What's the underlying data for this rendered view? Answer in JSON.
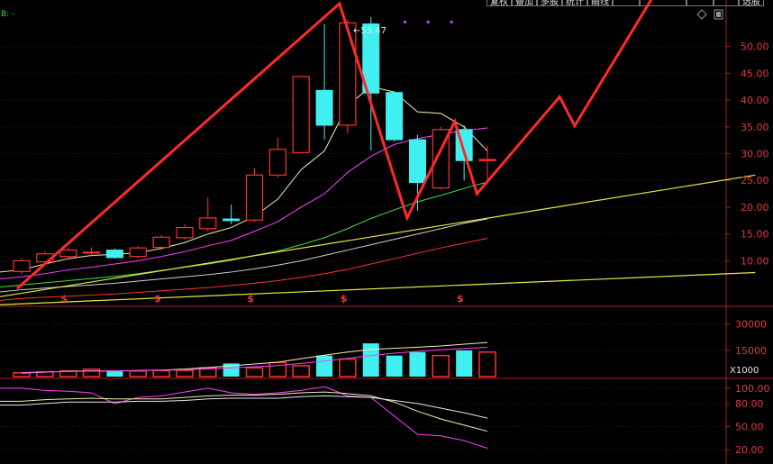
{
  "header": {
    "tabs": [
      "复权",
      "叠加",
      "多股",
      "统计",
      "画线",
      "",
      "",
      "",
      "",
      "选股"
    ],
    "indicator_text": "B: -",
    "icons": [
      "diamond-icon",
      "window-icon",
      "close-icon"
    ]
  },
  "chart_data": {
    "type": "candlestick",
    "price_axis": {
      "ticks": [
        10,
        15,
        20,
        25,
        30,
        35,
        40,
        45,
        50
      ],
      "ylim": [
        1.5,
        58
      ],
      "tick_labels": [
        "10.00",
        "15.00",
        "20.00",
        "25.00",
        "30.00",
        "35.00",
        "40.00",
        "45.00",
        "50.00"
      ]
    },
    "high_label": "55.47",
    "candles": [
      {
        "o": 8.0,
        "c": 10.0,
        "h": 10.5,
        "l": 7.5,
        "up": true
      },
      {
        "o": 9.8,
        "c": 11.3,
        "h": 11.8,
        "l": 9.5,
        "up": true
      },
      {
        "o": 10.8,
        "c": 12.0,
        "h": 12.4,
        "l": 10.5,
        "up": true
      },
      {
        "o": 11.5,
        "c": 11.6,
        "h": 12.5,
        "l": 10.8,
        "up": true
      },
      {
        "o": 12.0,
        "c": 10.6,
        "h": 12.3,
        "l": 10.4,
        "up": false
      },
      {
        "o": 10.8,
        "c": 12.4,
        "h": 12.8,
        "l": 10.5,
        "up": true
      },
      {
        "o": 12.5,
        "c": 14.4,
        "h": 14.8,
        "l": 12.0,
        "up": true
      },
      {
        "o": 14.3,
        "c": 16.2,
        "h": 16.8,
        "l": 14.0,
        "up": true
      },
      {
        "o": 16.0,
        "c": 18.0,
        "h": 21.8,
        "l": 15.5,
        "up": true
      },
      {
        "o": 17.5,
        "c": 17.8,
        "h": 20.5,
        "l": 16.8,
        "up": false
      },
      {
        "o": 17.6,
        "c": 26.0,
        "h": 27.3,
        "l": 17.3,
        "up": true
      },
      {
        "o": 26.0,
        "c": 30.8,
        "h": 33.0,
        "l": 25.5,
        "up": true
      },
      {
        "o": 30.2,
        "c": 44.4,
        "h": 44.4,
        "l": 30.2,
        "up": true
      },
      {
        "o": 41.8,
        "c": 35.3,
        "h": 54.2,
        "l": 32.6,
        "up": false
      },
      {
        "o": 35.3,
        "c": 54.4,
        "h": 55.0,
        "l": 33.7,
        "up": true
      },
      {
        "o": 54.2,
        "c": 41.3,
        "h": 55.5,
        "l": 30.6,
        "up": false
      },
      {
        "o": 41.4,
        "c": 32.6,
        "h": 41.5,
        "l": 32.2,
        "up": false
      },
      {
        "o": 32.6,
        "c": 24.6,
        "h": 33.5,
        "l": 19.3,
        "up": false
      },
      {
        "o": 23.6,
        "c": 34.5,
        "h": 35.0,
        "l": 23.3,
        "up": true
      },
      {
        "o": 34.5,
        "c": 28.7,
        "h": 35.3,
        "l": 25.0,
        "up": false
      },
      {
        "o": 28.7,
        "c": 28.9,
        "h": 31.5,
        "l": 24.3,
        "up": true
      }
    ],
    "moving_averages": [
      {
        "color": "#f0f0b0",
        "values": [
          8.3,
          9.4,
          10.4,
          11.0,
          11.2,
          11.5,
          12.3,
          13.4,
          15.0,
          16.2,
          18.3,
          21.5,
          27.0,
          30.5,
          39.0,
          42.5,
          41.5,
          37.8,
          37.5,
          35.0,
          30.5
        ]
      },
      {
        "color": "#ff40ff",
        "values": [
          7.0,
          7.6,
          8.3,
          8.8,
          9.4,
          10.0,
          10.8,
          11.7,
          12.8,
          13.8,
          15.5,
          17.3,
          20.0,
          22.5,
          26.5,
          29.5,
          31.7,
          32.8,
          33.6,
          34.3,
          34.8
        ]
      },
      {
        "color": "#40e040",
        "values": [
          5.5,
          5.9,
          6.3,
          6.7,
          7.1,
          7.6,
          8.2,
          8.8,
          9.4,
          10.1,
          11.0,
          11.8,
          13.0,
          14.3,
          16.0,
          17.9,
          19.5,
          21.0,
          22.2,
          23.5,
          24.7
        ]
      },
      {
        "color": "#d0d0d0",
        "values": [
          4.6,
          4.9,
          5.2,
          5.5,
          5.8,
          6.2,
          6.6,
          7.0,
          7.4,
          7.9,
          8.5,
          9.2,
          10.0,
          11.0,
          12.0,
          13.0,
          14.0,
          15.0,
          16.0,
          17.0,
          17.8
        ]
      },
      {
        "color": "#ff3030",
        "values": [
          3.0,
          3.2,
          3.4,
          3.6,
          3.8,
          4.1,
          4.4,
          4.7,
          5.0,
          5.4,
          5.8,
          6.3,
          6.9,
          7.6,
          8.4,
          9.4,
          10.4,
          11.4,
          12.4,
          13.3,
          14.2
        ]
      }
    ],
    "trend_lines": [
      {
        "color": "#e8e840",
        "points": [
          [
            0,
            3.3
          ],
          [
            31.5,
            26.0
          ]
        ]
      },
      {
        "color": "#e8e840",
        "points": [
          [
            0,
            1.8
          ],
          [
            31.5,
            7.8
          ]
        ]
      }
    ],
    "hand_drawn_zigzag": {
      "color": "#ff2a2a",
      "points": [
        [
          -0.2,
          4.8
        ],
        [
          13.65,
          58.0
        ],
        [
          16.55,
          18.0
        ],
        [
          18.6,
          36.0
        ],
        [
          19.55,
          22.5
        ],
        [
          23.1,
          40.6
        ],
        [
          23.75,
          35.2
        ],
        [
          27.35,
          61.0
        ]
      ]
    },
    "purple_dots": [
      16.4,
      17.4,
      18.4
    ],
    "dividend_markers": {
      "symbol": "$",
      "indices": [
        1.8,
        5.8,
        9.8,
        13.8,
        18.8
      ]
    },
    "volume": {
      "ticks": [
        15000,
        30000
      ],
      "tick_labels": [
        "15000",
        "30000"
      ],
      "unit": "X1000",
      "max": 36000,
      "values": [
        2200,
        2800,
        3200,
        4200,
        3000,
        3200,
        3500,
        3600,
        5000,
        7500,
        5000,
        8000,
        6200,
        12000,
        10000,
        19000,
        12000,
        14000,
        12000,
        15000,
        14000
      ],
      "ma": [
        {
          "color": "#f0f0b0",
          "values": [
            2000,
            2500,
            3000,
            3300,
            3300,
            3500,
            3700,
            4300,
            5200,
            6200,
            7200,
            8200,
            10200,
            12200,
            14000,
            15500,
            16200,
            16800,
            17500,
            18500,
            19500
          ]
        },
        {
          "color": "#ff40ff",
          "values": [
            2400,
            2600,
            2900,
            3100,
            3200,
            3400,
            3600,
            3900,
            4400,
            5000,
            5600,
            6300,
            7500,
            8900,
            10400,
            12000,
            13400,
            14400,
            15300,
            16100,
            16700
          ]
        }
      ]
    },
    "oscillator": {
      "ticks": [
        20,
        50,
        80,
        100
      ],
      "tick_labels": [
        "20.00",
        "50.00",
        "80.00",
        "100.00"
      ],
      "k": [
        100,
        97,
        96,
        94,
        80,
        88,
        90,
        95,
        100,
        94,
        92,
        94,
        97,
        102,
        90,
        88,
        64,
        40,
        38,
        32,
        22
      ],
      "d": [
        83,
        85,
        86,
        87,
        86,
        86,
        86,
        88,
        90,
        91,
        91,
        92,
        94,
        95,
        93,
        90,
        82,
        70,
        60,
        52,
        44
      ],
      "j": [
        78,
        80,
        82,
        82,
        82,
        83,
        83,
        84,
        86,
        87,
        87,
        87,
        89,
        90,
        89,
        88,
        84,
        80,
        74,
        68,
        61
      ]
    }
  }
}
